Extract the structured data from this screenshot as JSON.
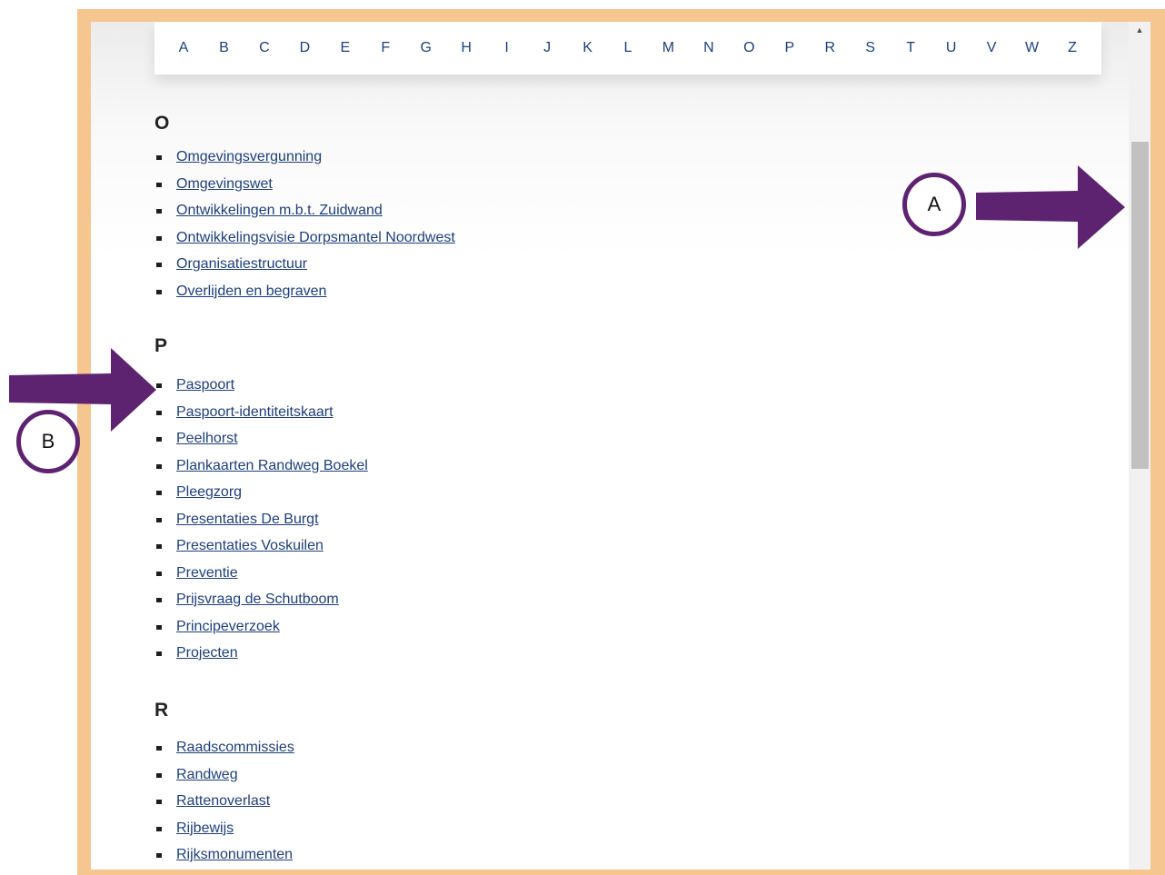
{
  "alphabet": [
    "A",
    "B",
    "C",
    "D",
    "E",
    "F",
    "G",
    "H",
    "I",
    "J",
    "K",
    "L",
    "M",
    "N",
    "O",
    "P",
    "R",
    "S",
    "T",
    "U",
    "V",
    "W",
    "Z"
  ],
  "sections": [
    {
      "heading": "O",
      "items": [
        "Omgevingsvergunning",
        "Omgevingswet",
        "Ontwikkelingen m.b.t. Zuidwand",
        "Ontwikkelingsvisie Dorpsmantel Noordwest",
        "Organisatiestructuur",
        "Overlijden en begraven"
      ]
    },
    {
      "heading": "P",
      "items": [
        "Paspoort",
        "Paspoort-identiteitskaart",
        "Peelhorst",
        "Plankaarten Randweg Boekel",
        "Pleegzorg",
        "Presentaties De Burgt",
        "Presentaties Voskuilen",
        "Preventie",
        "Prijsvraag de Schutboom",
        "Principeverzoek",
        "Projecten"
      ]
    },
    {
      "heading": "R",
      "items": [
        "Raadscommissies",
        "Randweg",
        "Rattenoverlast",
        "Rijbewijs",
        "Rijksmonumenten"
      ]
    }
  ],
  "annotations": {
    "marker_a": "A",
    "marker_b": "B",
    "color": "#5e2370"
  },
  "colors": {
    "frame": "#f5c690",
    "link": "#1d3f7a",
    "arrow": "#5e2370"
  }
}
